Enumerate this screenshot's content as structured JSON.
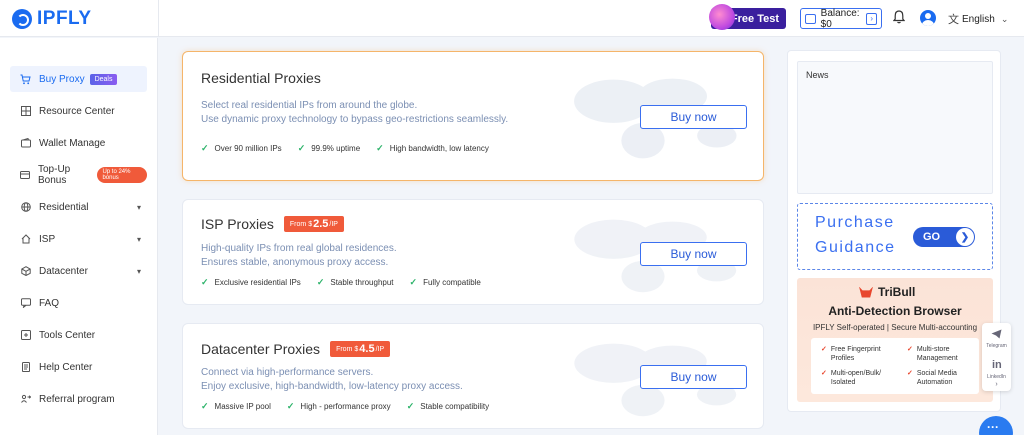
{
  "header": {
    "logo": "IPFLY",
    "free_test": "Free Test",
    "balance": "Balance: $0",
    "language": "English"
  },
  "sidebar": {
    "items": [
      {
        "label": "Buy Proxy",
        "badge": "Deals",
        "icon": "cart-icon"
      },
      {
        "label": "Resource Center",
        "icon": "grid-icon"
      },
      {
        "label": "Wallet Manage",
        "icon": "wallet-icon"
      },
      {
        "label": "Top-Up Bonus",
        "badge": "Up to 24% bonus",
        "icon": "card-icon"
      },
      {
        "label": "Residential",
        "icon": "globe-icon"
      },
      {
        "label": "ISP",
        "icon": "home-icon"
      },
      {
        "label": "Datacenter",
        "icon": "cube-icon"
      },
      {
        "label": "FAQ",
        "icon": "chat-icon"
      },
      {
        "label": "Tools Center",
        "icon": "tools-icon"
      },
      {
        "label": "Help Center",
        "icon": "document-icon"
      },
      {
        "label": "Referral program",
        "icon": "referral-icon"
      }
    ]
  },
  "cards": [
    {
      "title": "Residential Proxies",
      "desc1": "Select real residential IPs from around the globe.",
      "desc2": "Use dynamic proxy technology to bypass geo-restrictions seamlessly.",
      "features": [
        "Over 90 million IPs",
        "99.9% uptime",
        "High bandwidth, low latency"
      ],
      "button": "Buy now"
    },
    {
      "title": "ISP Proxies",
      "from": "From",
      "currency": "$",
      "price": "2.5",
      "unit": "/IP",
      "desc1": "High-quality IPs from real global residences.",
      "desc2": "Ensures stable, anonymous proxy access.",
      "features": [
        "Exclusive residential IPs",
        "Stable throughput",
        "Fully compatible"
      ],
      "button": "Buy now"
    },
    {
      "title": "Datacenter Proxies",
      "from": "From",
      "currency": "$",
      "price": "4.5",
      "unit": "/IP",
      "desc1": "Connect via high-performance servers.",
      "desc2": "Enjoy exclusive, high-bandwidth, low-latency proxy access.",
      "features": [
        "Massive IP pool",
        "High - performance proxy",
        "Stable compatibility"
      ],
      "button": "Buy now"
    }
  ],
  "right": {
    "news_title": "News",
    "purchase_line1": "Purchase",
    "purchase_line2": "Guidance",
    "go": "GO",
    "tribull_brand": "TriBull",
    "tribull_headline": "Anti-Detection Browser",
    "tribull_sub": "IPFLY Self-operated | Secure Multi-accounting",
    "tribull_features": [
      {
        "l1": "Free Fingerprint",
        "l2": "Profiles"
      },
      {
        "l1": "Multi-store",
        "l2": "Management"
      },
      {
        "l1": "Multi-open/Bulk/",
        "l2": "Isolated"
      },
      {
        "l1": "Social Media",
        "l2": "Automation"
      }
    ]
  },
  "social": {
    "telegram": "Telegram",
    "linkedin_icon": "in",
    "linkedin": "LinkedIn"
  },
  "colors": {
    "accent": "#1a6bf0",
    "badge_red": "#f05a3a",
    "check_green": "#2cb36a",
    "highlight_border": "#f5b56a"
  }
}
